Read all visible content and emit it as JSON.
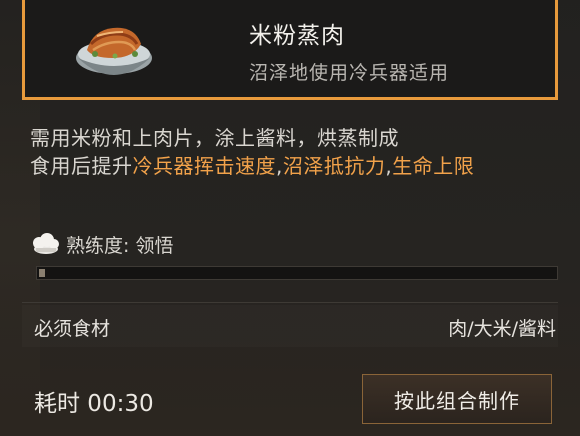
{
  "item": {
    "name": "米粉蒸肉",
    "subtitle": "沼泽地使用冷兵器适用"
  },
  "description": {
    "line1": "需用米粉和上肉片，涂上酱料，烘蒸制成",
    "prefix": "食用后提升",
    "buff1": "冷兵器挥击速度",
    "sep1": ",",
    "buff2": "沼泽抵抗力",
    "sep2": ",",
    "buff3": "生命上限"
  },
  "proficiency": {
    "label": "熟练度: 领悟",
    "progress_fraction": 0.01
  },
  "ingredients": {
    "label": "必须食材",
    "value": "肉/大米/酱料"
  },
  "time": {
    "label": "耗时 00:30"
  },
  "actions": {
    "craft_label": "按此组合制作"
  },
  "colors": {
    "accent": "#e79a3c",
    "highlight_text": "#f2a24a"
  },
  "icons": {
    "dish": "steamed-rice-flour-pork-bowl-icon",
    "proficiency": "chef-hat-icon"
  }
}
